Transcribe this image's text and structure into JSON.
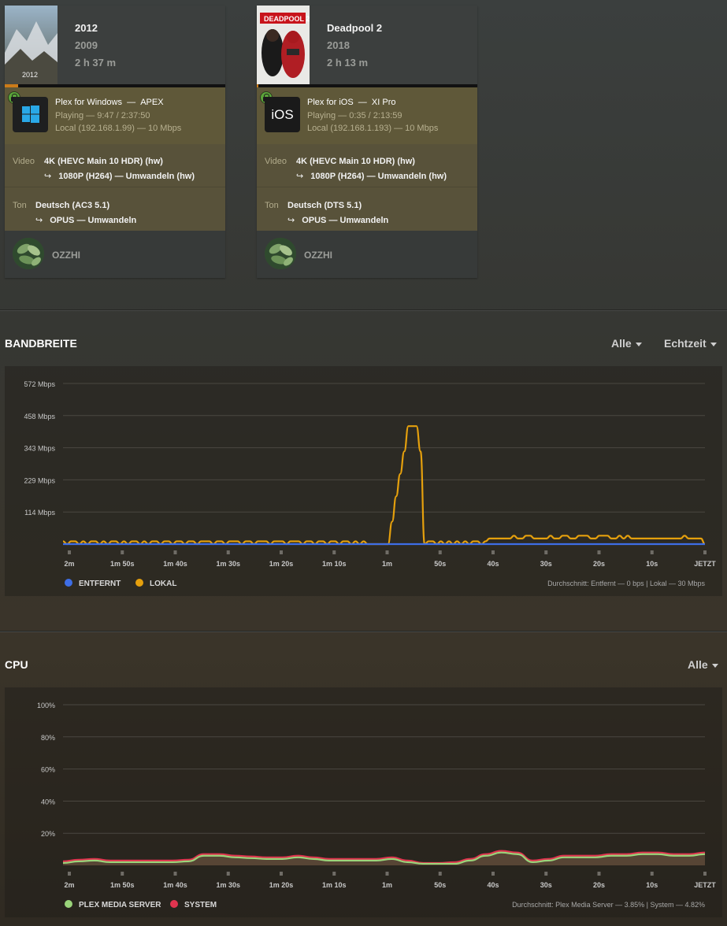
{
  "sessions": [
    {
      "title": "2012",
      "year": "2009",
      "duration": "2 h 37 m",
      "progress_fraction": 0.062,
      "player_name": "Plex for Windows",
      "device": "APEX",
      "player_icon": "windows-icon",
      "status": "Playing",
      "position": "9:47 / 2:37:50",
      "network": "Local (192.168.1.99) — 10 Mbps",
      "video_label": "Video",
      "video_source": "4K (HEVC Main 10 HDR) (hw)",
      "video_target": "1080P (H264) — Umwandeln (hw)",
      "audio_label": "Ton",
      "audio_source": "Deutsch (AC3 5.1)",
      "audio_target": "OPUS — Umwandeln",
      "user": "OZZHI"
    },
    {
      "title": "Deadpool 2",
      "year": "2018",
      "duration": "2 h 13 m",
      "progress_fraction": 0.004,
      "player_name": "Plex for iOS",
      "device": "XI Pro",
      "player_icon_text": "iOS",
      "status": "Playing",
      "position": "0:35 / 2:13:59",
      "network": "Local (192.168.1.193) — 10 Mbps",
      "video_label": "Video",
      "video_source": "4K (HEVC Main 10 HDR) (hw)",
      "video_target": "1080P (H264) — Umwandeln (hw)",
      "audio_label": "Ton",
      "audio_source": "Deutsch (DTS 5.1)",
      "audio_target": "OPUS — Umwandeln",
      "user": "OZZHI"
    }
  ],
  "bandwidth": {
    "title": "BANDBREITE",
    "filter_scope": "Alle",
    "filter_time": "Echtzeit",
    "legend_remote": "ENTFERNT",
    "legend_local": "LOKAL",
    "average": "Durchschnitt: Entfernt — 0 bps | Lokal — 30 Mbps",
    "colors": {
      "remote": "#3e6ee6",
      "local": "#e5a00d"
    }
  },
  "cpu": {
    "title": "CPU",
    "filter_scope": "Alle",
    "legend_pms": "PLEX MEDIA SERVER",
    "legend_system": "SYSTEM",
    "average": "Durchschnitt: Plex Media Server — 3.85% | System — 4.82%",
    "colors": {
      "pms": "#9ad47a",
      "system": "#e0344f"
    }
  },
  "chart_data": [
    {
      "type": "line",
      "title": "BANDBREITE",
      "x": [
        "2m",
        "1m 50s",
        "1m 40s",
        "1m 30s",
        "1m 20s",
        "1m 10s",
        "1m",
        "50s",
        "40s",
        "30s",
        "20s",
        "10s",
        "JETZT"
      ],
      "y_ticks": [
        "114 Mbps",
        "229 Mbps",
        "343 Mbps",
        "458 Mbps",
        "572 Mbps"
      ],
      "ylim": [
        0,
        572
      ],
      "grid": true,
      "legend_placement": "bottom-left",
      "series": [
        {
          "name": "ENTFERNT",
          "values": [
            0,
            0,
            0,
            0,
            0,
            0,
            0,
            0,
            0,
            0,
            0,
            0,
            0,
            0,
            0,
            0,
            0,
            0,
            0,
            0,
            0,
            0,
            0,
            0,
            0,
            0,
            0,
            0,
            0,
            0,
            0,
            0,
            0,
            0,
            0,
            0,
            0,
            0,
            0,
            0,
            0,
            0,
            0,
            0,
            0,
            0,
            0,
            0,
            0,
            0,
            0,
            0,
            0,
            0,
            0,
            0,
            0,
            0,
            0,
            0,
            0,
            0,
            0,
            0,
            0,
            0,
            0,
            0,
            0,
            0,
            0,
            0,
            0,
            0,
            0,
            0,
            0,
            0,
            0,
            0,
            0,
            0,
            0,
            0,
            0,
            0,
            0,
            0,
            0,
            0,
            0,
            0,
            0,
            0,
            0,
            0,
            0,
            0,
            0,
            0,
            0,
            0,
            0,
            0,
            0,
            0,
            0,
            0,
            0,
            0,
            0,
            0,
            0,
            0,
            0,
            0,
            0,
            0,
            0,
            0,
            0
          ]
        },
        {
          "name": "LOKAL",
          "values": [
            10,
            0,
            10,
            10,
            0,
            10,
            0,
            10,
            10,
            0,
            10,
            0,
            10,
            10,
            0,
            10,
            0,
            10,
            10,
            0,
            10,
            0,
            10,
            10,
            0,
            10,
            10,
            0,
            10,
            10,
            0,
            10,
            10,
            0,
            10,
            10,
            10,
            0,
            10,
            10,
            0,
            10,
            10,
            10,
            0,
            10,
            10,
            0,
            10,
            10,
            10,
            0,
            10,
            10,
            10,
            0,
            10,
            10,
            10,
            0,
            10,
            10,
            0,
            10,
            10,
            0,
            10,
            10,
            0,
            10,
            10,
            0,
            10,
            0,
            10,
            0,
            0,
            0,
            0,
            0,
            0,
            80,
            170,
            250,
            330,
            420,
            420,
            420,
            330,
            0,
            10,
            10,
            0,
            10,
            0,
            10,
            0,
            10,
            0,
            10,
            0,
            10,
            10,
            0,
            10,
            20,
            20,
            20,
            20,
            20,
            20,
            30,
            20,
            20,
            30,
            30,
            20,
            20,
            20,
            20,
            30,
            20,
            20,
            30,
            30,
            20,
            20,
            30,
            30,
            30,
            20,
            20,
            30,
            30,
            30,
            20,
            20,
            30,
            20,
            30,
            20,
            20,
            20,
            20,
            20,
            20,
            20,
            20,
            20,
            20,
            20,
            20,
            20,
            30,
            20,
            20,
            20,
            20,
            0
          ]
        }
      ]
    },
    {
      "type": "area",
      "title": "CPU",
      "x": [
        "2m",
        "1m 50s",
        "1m 40s",
        "1m 30s",
        "1m 20s",
        "1m 10s",
        "1m",
        "50s",
        "40s",
        "30s",
        "20s",
        "10s",
        "JETZT"
      ],
      "y_ticks": [
        "20%",
        "40%",
        "60%",
        "80%",
        "100%"
      ],
      "ylim": [
        0,
        100
      ],
      "grid": true,
      "legend_placement": "bottom-left",
      "series": [
        {
          "name": "PLEX MEDIA SERVER",
          "values": [
            1.5,
            2.5,
            3,
            2,
            2,
            2,
            2,
            2,
            2.5,
            6,
            6,
            5,
            4.5,
            4,
            4,
            5,
            4,
            3,
            3,
            3,
            3,
            4,
            2,
            1,
            1,
            1,
            3,
            6,
            8,
            7,
            2,
            3,
            5,
            5,
            5,
            6,
            6,
            7,
            7,
            6,
            6,
            7
          ]
        },
        {
          "name": "SYSTEM",
          "values": [
            2.5,
            3.5,
            4,
            3,
            3,
            3,
            3,
            3,
            3.5,
            7,
            7,
            6,
            5.5,
            5,
            5,
            6,
            5,
            4,
            4,
            4,
            4,
            5,
            3,
            1.5,
            1.5,
            2,
            4,
            7,
            9,
            8,
            3,
            4,
            6,
            6,
            6,
            7,
            7,
            8,
            8,
            7,
            7,
            8
          ]
        }
      ]
    }
  ]
}
